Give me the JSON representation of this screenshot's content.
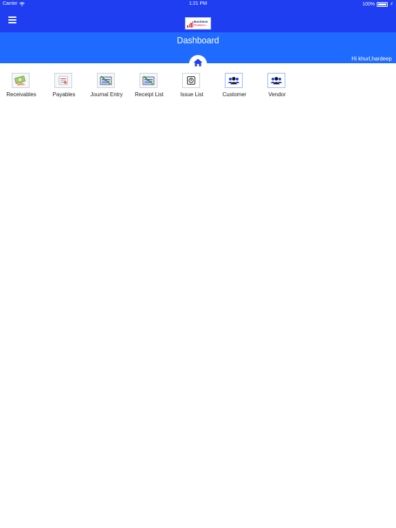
{
  "status_bar": {
    "carrier": "Carrier",
    "time": "1:21 PM",
    "battery": "100%",
    "battery_level": 1.0
  },
  "nav_bar": {
    "menu_icon": "hamburger-menu-icon",
    "logo_line1": "Business",
    "logo_line2": "Pointers...."
  },
  "header": {
    "title": "Dashboard",
    "greeting": "Hi khurl,hardeep",
    "home_icon": "home-icon"
  },
  "colors": {
    "nav_blue": "#1f3ef2",
    "header_blue": "#1f6bff",
    "icon_blue": "#1f3ef2"
  },
  "tiles": [
    {
      "label": "Receivables",
      "icon": "receivables-icon"
    },
    {
      "label": "Payables",
      "icon": "payables-icon"
    },
    {
      "label": "Journal Entry",
      "icon": "journal-entry-icon"
    },
    {
      "label": "Receipt List",
      "icon": "receipt-list-icon"
    },
    {
      "label": "Issue List",
      "icon": "issue-list-icon"
    },
    {
      "label": "Customer",
      "icon": "customer-icon"
    },
    {
      "label": "Vendor",
      "icon": "vendor-icon"
    }
  ]
}
